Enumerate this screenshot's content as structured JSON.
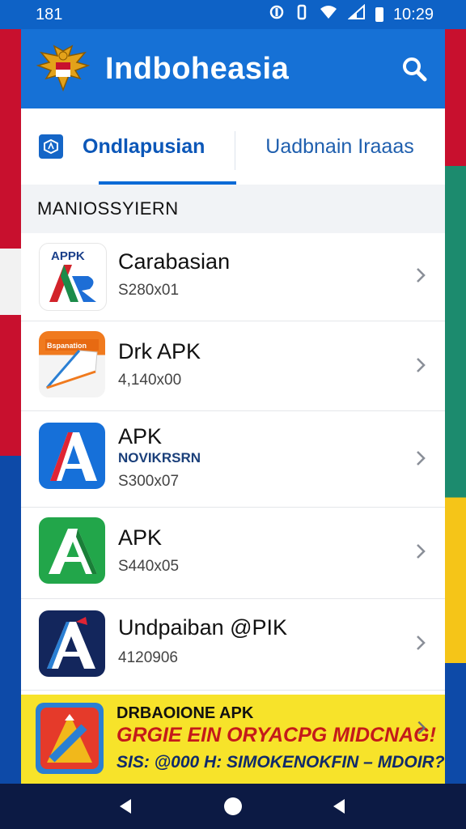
{
  "status_bar": {
    "time_left": "181",
    "time": "10:29"
  },
  "app": {
    "title": "Indboheasia",
    "search_icon": "search-icon",
    "emblem_icon": "garuda-emblem-icon"
  },
  "tabs": [
    {
      "label": "Ondlapusian",
      "selected": true
    },
    {
      "label": "Uadbnain Iraaas",
      "selected": false
    }
  ],
  "section": {
    "title": "MANIOSSYIERN"
  },
  "apps": [
    {
      "name": "Carabasian",
      "sub": "",
      "size": "S280x01",
      "icon": "apk-a-red-blue-icon"
    },
    {
      "name": "Drk APK",
      "sub": "",
      "size": "4,140x00",
      "icon": "orange-paper-apk-icon"
    },
    {
      "name": "APK",
      "sub": "NOVIKRSRN",
      "size": "S300x07",
      "icon": "blue-a-apk-icon"
    },
    {
      "name": "APK",
      "sub": "",
      "size": "S440x05",
      "icon": "green-a-apk-icon"
    },
    {
      "name": "Undpaiban @PIK",
      "sub": "",
      "size": "4120906",
      "icon": "navy-a-apk-icon"
    }
  ],
  "banner": {
    "line1": "DRBAOIONE APK",
    "line2": "GRGIE EIN ORYACPG MIDCNAG!",
    "line3": "SIS: @000 H: SIMOKENOKFIN – MDOIR?",
    "icon": "apk-promo-icon"
  },
  "nav": {
    "back": "back-icon",
    "home": "home-icon",
    "recents": "recents-icon"
  },
  "colors": {
    "primary": "#1671d6",
    "banner": "#f7e32a",
    "accent_red": "#c41a1a"
  }
}
